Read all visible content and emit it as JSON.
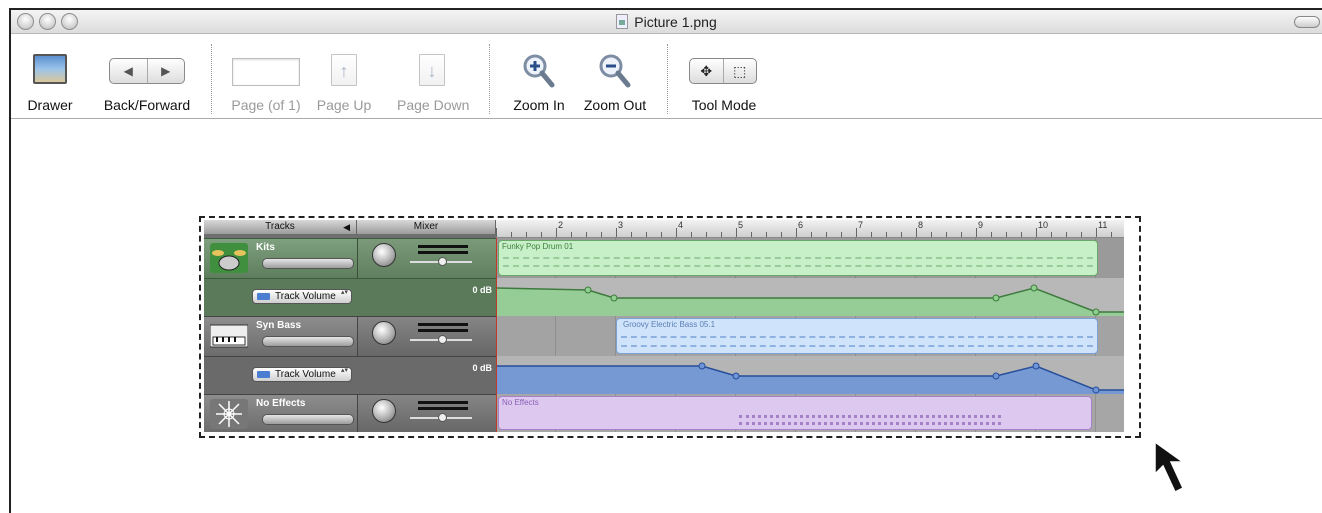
{
  "window": {
    "title": "Picture 1.png"
  },
  "toolbar": {
    "drawer_label": "Drawer",
    "back_forward_label": "Back/Forward",
    "back_glyph": "◀",
    "forward_glyph": "▶",
    "page_label": "Page (of 1)",
    "page_up_label": "Page Up",
    "page_down_label": "Page Down",
    "zoom_in_label": "Zoom In",
    "zoom_out_label": "Zoom Out",
    "tool_mode_label": "Tool Mode",
    "tool_move_glyph": "✥",
    "tool_select_glyph": "⬚"
  },
  "garageband": {
    "tracks_header": "Tracks",
    "mixer_header": "Mixer",
    "ruler_numbers": [
      "2",
      "3",
      "4",
      "5",
      "6",
      "7",
      "8",
      "9",
      "10",
      "11"
    ],
    "tracks": [
      {
        "name": "Kits",
        "automation_popup": "Track Volume",
        "db_label": "0 dB",
        "region_name": "Funky Pop Drum 01"
      },
      {
        "name": "Syn Bass",
        "automation_popup": "Track Volume",
        "db_label": "0 dB",
        "region_name": "Groovy Electric Bass 05.1"
      },
      {
        "name": "No Effects",
        "region_name": "No Effects"
      }
    ]
  },
  "colors": {
    "kits_region": "#c8f0c8",
    "bass_region": "#cfe3fb",
    "effects_region": "#ddc9f0",
    "bass_automation": "#6f95d6",
    "kits_automation": "#8fcf8f"
  }
}
